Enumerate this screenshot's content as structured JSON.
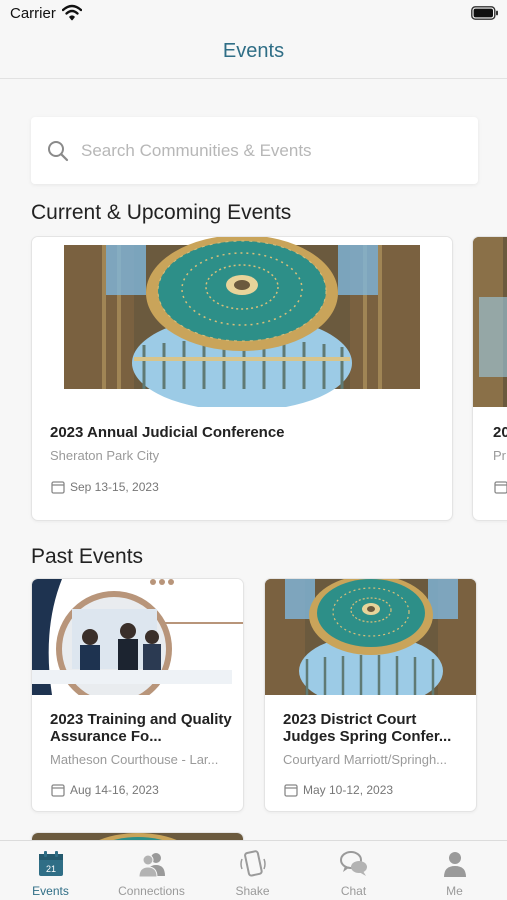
{
  "status_bar": {
    "carrier": "Carrier"
  },
  "nav": {
    "title": "Events"
  },
  "search": {
    "placeholder": "Search Communities & Events"
  },
  "sections": {
    "current": "Current & Upcoming Events",
    "past": "Past Events"
  },
  "current_events": [
    {
      "title": "2023 Annual Judicial Conference",
      "location": "Sheraton Park City",
      "date": "Sep 13-15, 2023"
    },
    {
      "title": "20",
      "location": "Pr"
    }
  ],
  "past_events": [
    {
      "title": "2023 Training and Quality Assurance Fo...",
      "location": "Matheson Courthouse - Lar...",
      "date": "Aug 14-16, 2023"
    },
    {
      "title": "2023 District Court Judges Spring Confer...",
      "location": "Courtyard Marriott/Springh...",
      "date": "May 10-12, 2023"
    }
  ],
  "tabbar": {
    "items": [
      {
        "label": "Events",
        "icon": "calendar-icon",
        "badge": "21",
        "active": true
      },
      {
        "label": "Connections",
        "icon": "people-icon"
      },
      {
        "label": "Shake",
        "icon": "phone-shake-icon"
      },
      {
        "label": "Chat",
        "icon": "chat-bubbles-icon"
      },
      {
        "label": "Me",
        "icon": "person-icon"
      }
    ]
  },
  "colors": {
    "accent": "#2f6e86",
    "dome_teal": "#2d8f88",
    "dome_gold": "#c9a45a"
  }
}
